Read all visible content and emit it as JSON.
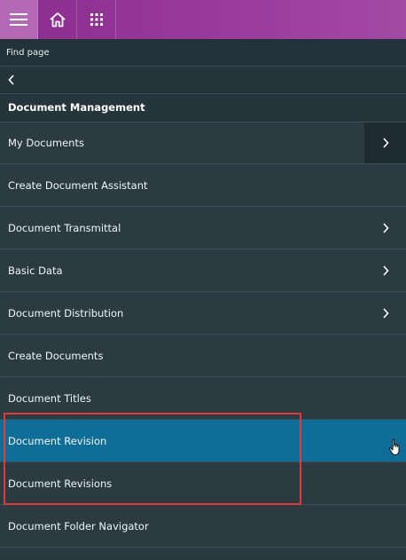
{
  "topbar": {
    "menu_icon": "hamburger-icon",
    "home_icon": "home-icon",
    "apps_icon": "apps-grid-icon",
    "accent": "#8a2d8e"
  },
  "find_page": {
    "label": "Find page"
  },
  "back": {
    "icon": "chevron-left-icon"
  },
  "section": {
    "title": "Document Management"
  },
  "items": [
    {
      "label": "My Documents",
      "has_children": true
    },
    {
      "label": "Create Document Assistant",
      "has_children": false
    },
    {
      "label": "Document Transmittal",
      "has_children": true
    },
    {
      "label": "Basic Data",
      "has_children": true
    },
    {
      "label": "Document Distribution",
      "has_children": true
    },
    {
      "label": "Create Documents",
      "has_children": false
    },
    {
      "label": "Document Titles",
      "has_children": false
    },
    {
      "label": "Document Revision",
      "has_children": false,
      "selected": true
    },
    {
      "label": "Document Revisions",
      "has_children": false
    },
    {
      "label": "Document Folder Navigator",
      "has_children": false
    }
  ],
  "colors": {
    "selected": "#0f6e98",
    "highlight_border": "#e03a3a",
    "background": "#2c3b41"
  }
}
